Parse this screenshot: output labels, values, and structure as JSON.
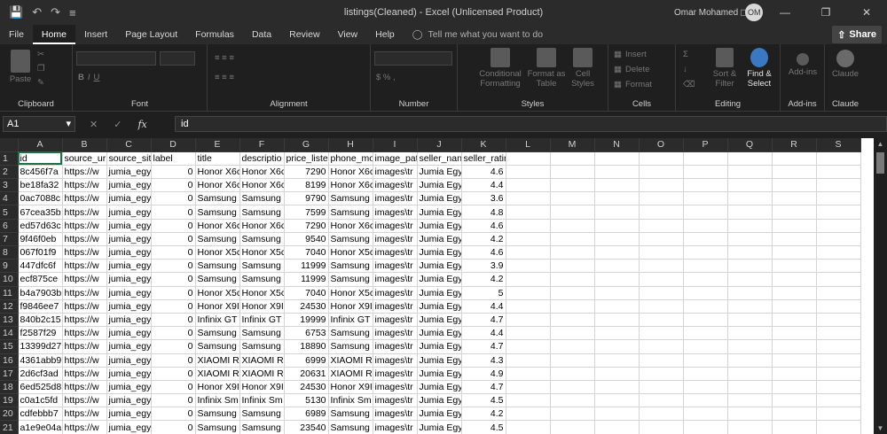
{
  "window": {
    "title": "listings(Cleaned)  -  Excel (Unlicensed Product)",
    "user_name": "Omar Mohamed",
    "user_initials": "OM"
  },
  "ribbon_tabs": [
    "File",
    "Home",
    "Insert",
    "Page Layout",
    "Formulas",
    "Data",
    "Review",
    "View",
    "Help"
  ],
  "active_tab": "Home",
  "tell_me": "Tell me what you want to do",
  "share_label": "Share",
  "ribbon": {
    "clipboard": {
      "label": "Clipboard",
      "paste": "Paste"
    },
    "font": {
      "label": "Font"
    },
    "alignment": {
      "label": "Alignment"
    },
    "number": {
      "label": "Number"
    },
    "styles": {
      "label": "Styles",
      "conditional": "Conditional Formatting",
      "format_table": "Format as Table",
      "cell_styles": "Cell Styles"
    },
    "cells": {
      "label": "Cells",
      "insert": "Insert",
      "delete": "Delete",
      "format": "Format"
    },
    "editing": {
      "label": "Editing",
      "sort": "Sort & Filter",
      "find": "Find & Select"
    },
    "addins": {
      "label": "Add-ins",
      "button": "Add-ins"
    },
    "claude": {
      "label": "Claude",
      "button": "Claude"
    }
  },
  "formula_bar": {
    "name_box": "A1",
    "fx": "fx",
    "value": "id"
  },
  "columns": [
    "A",
    "B",
    "C",
    "D",
    "E",
    "F",
    "G",
    "H",
    "I",
    "J",
    "K",
    "L",
    "M",
    "N",
    "O",
    "P",
    "Q",
    "R",
    "S"
  ],
  "rows": [
    [
      "id",
      "source_ur",
      "source_sit",
      "label",
      "title",
      "descriptio",
      "price_liste",
      "phone_mo",
      "image_pat",
      "seller_nan",
      "seller_rating"
    ],
    [
      "8c456f7a",
      "https://w",
      "jumia_egy",
      "0",
      "Honor X6c",
      "Honor X6c",
      "7290",
      "Honor X6c",
      "images\\tr",
      "Jumia Egy",
      "4.6"
    ],
    [
      "be18fa32",
      "https://w",
      "jumia_egy",
      "0",
      "Honor X6c",
      "Honor X6c",
      "8199",
      "Honor X6c",
      "images\\tr",
      "Jumia Egy",
      "4.4"
    ],
    [
      "0ac7088c",
      "https://w",
      "jumia_egy",
      "0",
      "Samsung G",
      "Samsung G",
      "9790",
      "Samsung G",
      "images\\tr",
      "Jumia Egy",
      "3.6"
    ],
    [
      "67cea35b",
      "https://w",
      "jumia_egy",
      "0",
      "Samsung G",
      "Samsung G",
      "7599",
      "Samsung G",
      "images\\tr",
      "Jumia Egy",
      "4.8"
    ],
    [
      "ed57d63c",
      "https://w",
      "jumia_egy",
      "0",
      "Honor X6c",
      "Honor X6c",
      "7290",
      "Honor X6c",
      "images\\tr",
      "Jumia Egy",
      "4.6"
    ],
    [
      "9f46f0eb",
      "https://w",
      "jumia_egy",
      "0",
      "Samsung G",
      "Samsung G",
      "9540",
      "Samsung G",
      "images\\tr",
      "Jumia Egy",
      "4.2"
    ],
    [
      "067f01f9",
      "https://w",
      "jumia_egy",
      "0",
      "Honor X5c",
      "Honor X5c",
      "7040",
      "Honor X5c",
      "images\\tr",
      "Jumia Egy",
      "4.6"
    ],
    [
      "447dfc6f",
      "https://w",
      "jumia_egy",
      "0",
      "Samsung G",
      "Samsung G",
      "11999",
      "Samsung G",
      "images\\tr",
      "Jumia Egy",
      "3.9"
    ],
    [
      "ecf875ce",
      "https://w",
      "jumia_egy",
      "0",
      "Samsung G",
      "Samsung G",
      "11999",
      "Samsung G",
      "images\\tr",
      "Jumia Egy",
      "4.2"
    ],
    [
      "b4a7903b",
      "https://w",
      "jumia_egy",
      "0",
      "Honor X5c",
      "Honor X5c",
      "7040",
      "Honor X5c",
      "images\\tr",
      "Jumia Egy",
      "5"
    ],
    [
      "f9846ee7",
      "https://w",
      "jumia_egy",
      "0",
      "Honor X9I",
      "Honor X9I",
      "24530",
      "Honor X9I",
      "images\\tr",
      "Jumia Egy",
      "4.4"
    ],
    [
      "840b2c15",
      "https://w",
      "jumia_egy",
      "0",
      "Infinix GT",
      "Infinix GT",
      "19999",
      "Infinix GT",
      "images\\tr",
      "Jumia Egy",
      "4.7"
    ],
    [
      "f2587f29",
      "https://w",
      "jumia_egy",
      "0",
      "Samsung G",
      "Samsung G",
      "6753",
      "Samsung G",
      "images\\tr",
      "Jumia Egy",
      "4.4"
    ],
    [
      "13399d27",
      "https://w",
      "jumia_egy",
      "0",
      "Samsung G",
      "Samsung G",
      "18890",
      "Samsung G",
      "images\\tr",
      "Jumia Egy",
      "4.7"
    ],
    [
      "4361abb9",
      "https://w",
      "jumia_egy",
      "0",
      "XIAOMI Re",
      "XIAOMI Re",
      "6999",
      "XIAOMI Re",
      "images\\tr",
      "Jumia Egy",
      "4.3"
    ],
    [
      "2d6cf3ad",
      "https://w",
      "jumia_egy",
      "0",
      "XIAOMI Re",
      "XIAOMI Re",
      "20631",
      "XIAOMI Re",
      "images\\tr",
      "Jumia Egy",
      "4.9"
    ],
    [
      "6ed525d8",
      "https://w",
      "jumia_egy",
      "0",
      "Honor X9I",
      "Honor X9I",
      "24530",
      "Honor X9I",
      "images\\tr",
      "Jumia Egy",
      "4.7"
    ],
    [
      "c0a1c5fd",
      "https://w",
      "jumia_egy",
      "0",
      "Infinix Sm",
      "Infinix Sm",
      "5130",
      "Infinix Sm",
      "images\\tr",
      "Jumia Egy",
      "4.5"
    ],
    [
      "cdfebbb7",
      "https://w",
      "jumia_egy",
      "0",
      "Samsung G",
      "Samsung G",
      "6989",
      "Samsung G",
      "images\\tr",
      "Jumia Egy",
      "4.2"
    ],
    [
      "a1e9e04a",
      "https://w",
      "jumia_egy",
      "0",
      "Samsung G",
      "Samsung G",
      "23540",
      "Samsung G",
      "images\\tr",
      "Jumia Egy",
      "4.5"
    ]
  ]
}
